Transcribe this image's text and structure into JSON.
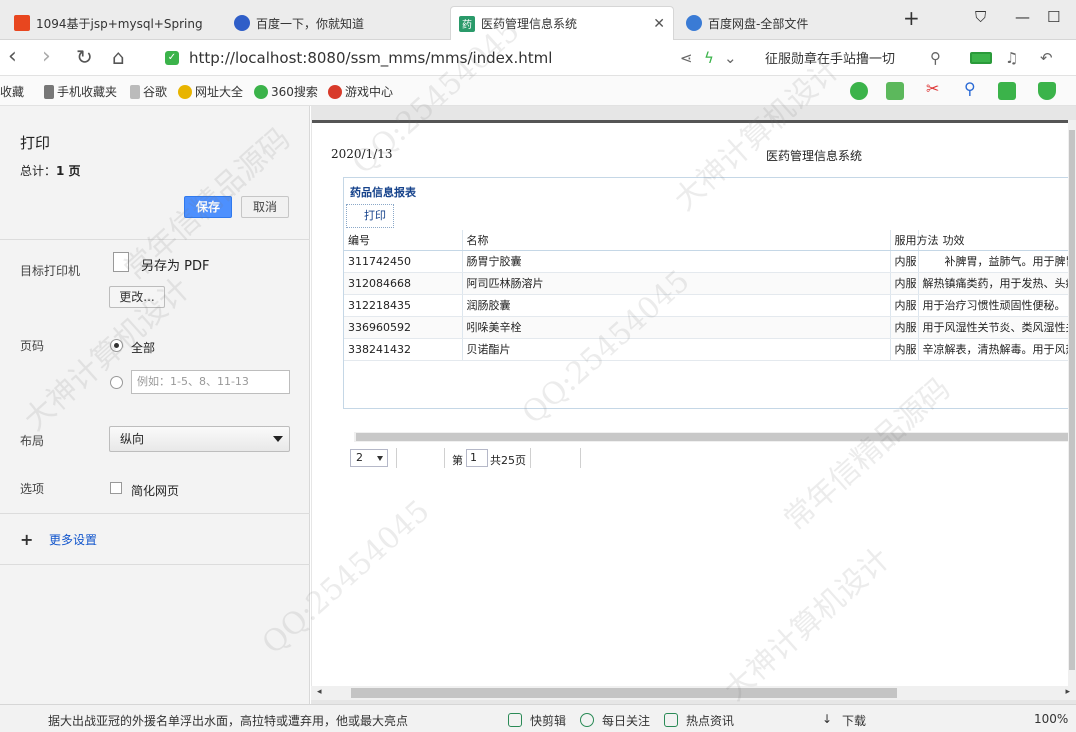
{
  "tabs": [
    {
      "label": "1094基于jsp+mysql+Spring",
      "icon": "square-orange-icon"
    },
    {
      "label": "百度一下，你就知道",
      "icon": "baidu-paw-icon"
    },
    {
      "label": "医药管理信息系统",
      "icon": "medicine-icon"
    },
    {
      "label": "百度网盘-全部文件",
      "icon": "cloud-icon"
    }
  ],
  "address": {
    "url": "http://localhost:8080/ssm_mms/mms/index.html",
    "slogan": "征服勋章在手站撸一切"
  },
  "bookmarks": [
    {
      "label": "收藏"
    },
    {
      "label": "手机收藏夹"
    },
    {
      "label": "谷歌"
    },
    {
      "label": "网址大全"
    },
    {
      "label": "360搜索"
    },
    {
      "label": "游戏中心"
    }
  ],
  "print": {
    "title": "打印",
    "total_label": "总计：",
    "total_value": "1 页",
    "save": "保存",
    "cancel": "取消",
    "destination_label": "目标打印机",
    "destination_value": "另存为 PDF",
    "change": "更改...",
    "pages_label": "页码",
    "pages_all": "全部",
    "pages_placeholder": "例如：1-5、8、11-13",
    "layout_label": "布局",
    "layout_value": "纵向",
    "options_label": "选项",
    "simplify": "简化网页",
    "more_settings": "更多设置"
  },
  "preview": {
    "date": "2020/1/13",
    "title": "医药管理信息系统",
    "grid_caption": "药品信息报表",
    "print_button": "打印",
    "columns": [
      "编号",
      "名称",
      "服用方法",
      "功效"
    ],
    "rows": [
      [
        "311742450",
        "肠胃宁胶囊",
        "内服",
        "　　补脾胃，益肺气。用于脾胃"
      ],
      [
        "312084668",
        "阿司匹林肠溶片",
        "内服",
        "解热镇痛类药，用于发热、头痛"
      ],
      [
        "312218435",
        "润肠胶囊",
        "内服",
        "用于治疗习惯性顽固性便秘。"
      ],
      [
        "336960592",
        "吲哚美辛栓",
        "内服",
        "用于风湿性关节炎、类风湿性关"
      ],
      [
        "338241432",
        "贝诺酯片",
        "内服",
        "辛凉解表，清热解毒。用于风热"
      ]
    ],
    "page_size": "2",
    "page_prefix": "第",
    "page_current": "1",
    "page_total": "共25页"
  },
  "status": {
    "news": "据大出战亚冠的外援名单浮出水面，高拉特或遭弃用，他或最大亮点",
    "quick_clip": "快剪辑",
    "daily_focus": "每日关注",
    "hot_news": "热点资讯",
    "download": "下载",
    "zoom": "100%"
  },
  "watermarks": [
    "QQ:25454045",
    "常年信精品源码",
    "大神计算机设计"
  ]
}
